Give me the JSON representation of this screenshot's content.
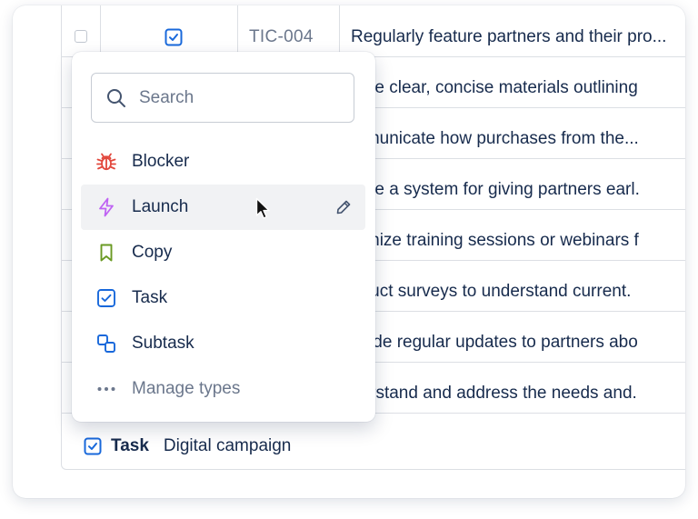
{
  "table": {
    "first_row": {
      "key": "TIC-004",
      "summary": "Regularly feature partners and their pro..."
    },
    "rows": [
      {
        "summary": "eate clear, concise materials outlining"
      },
      {
        "summary": "mmunicate how purchases from the..."
      },
      {
        "summary": "eate a system for giving partners earl."
      },
      {
        "summary": "ganize training sessions or webinars f"
      },
      {
        "summary": "nduct surveys to understand current."
      },
      {
        "summary": "ovide regular updates to partners abo"
      },
      {
        "summary": "derstand and address the needs and."
      }
    ],
    "footer": {
      "type_label": "Task",
      "summary": "Digital campaign"
    }
  },
  "dropdown": {
    "search_placeholder": "Search",
    "items": [
      {
        "label": "Blocker",
        "icon": "bug-icon",
        "color": "#e2483d"
      },
      {
        "label": "Launch",
        "icon": "lightning-icon",
        "color": "#bf63f3",
        "hovered": true
      },
      {
        "label": "Copy",
        "icon": "bookmark-icon",
        "color": "#6a9a23"
      },
      {
        "label": "Task",
        "icon": "checkbox-icon",
        "color": "#1868db"
      },
      {
        "label": "Subtask",
        "icon": "subtask-icon",
        "color": "#1868db"
      },
      {
        "label": "Manage types",
        "icon": "more-icon",
        "color": "#6b778c"
      }
    ]
  }
}
